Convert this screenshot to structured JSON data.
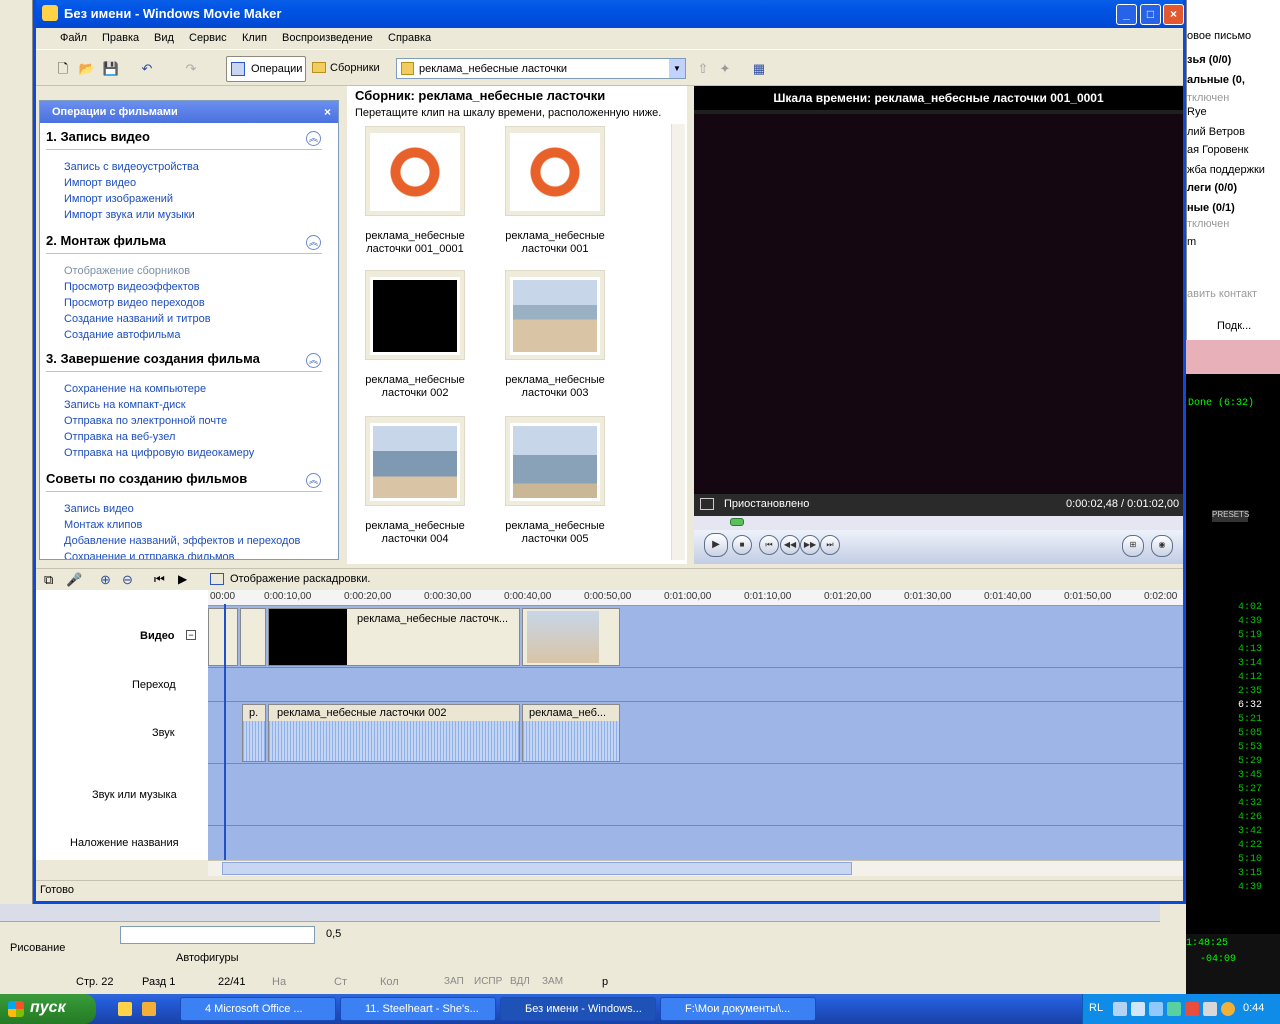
{
  "window": {
    "title": "Без имени - Windows Movie Maker"
  },
  "menu": [
    "Файл",
    "Правка",
    "Вид",
    "Сервис",
    "Клип",
    "Воспроизведение",
    "Справка"
  ],
  "toolbar": {
    "operations": "Операции",
    "collections": "Сборники",
    "collection_select": "реклама_небесные ласточки"
  },
  "tasks": {
    "header": "Операции с фильмами",
    "sections": [
      {
        "title": "1. Запись видео",
        "items": [
          "Запись с видеоустройства",
          "Импорт видео",
          "Импорт изображений",
          "Импорт звука или музыки"
        ]
      },
      {
        "title": "2. Монтаж фильма",
        "items": [
          "Отображение сборников",
          "Просмотр видеоэффектов",
          "Просмотр видео переходов",
          "Создание названий и титров",
          "Создание автофильма"
        ]
      },
      {
        "title": "3. Завершение создания фильма",
        "items": [
          "Сохранение на компьютере",
          "Запись на компакт-диск",
          "Отправка по электронной почте",
          "Отправка на веб-узел",
          "Отправка на цифровую видеокамеру"
        ]
      },
      {
        "title": "Советы по созданию фильмов",
        "items": [
          "Запись видео",
          "Монтаж клипов",
          "Добавление названий, эффектов и переходов",
          "Сохранение и отправка фильмов"
        ]
      }
    ]
  },
  "collection": {
    "title": "Сборник: реклама_небесные ласточки",
    "hint": "Перетащите клип на шкалу времени, расположенную ниже.",
    "clips": [
      {
        "line1": "реклама_небесные",
        "line2": "ласточки 001_0001"
      },
      {
        "line1": "реклама_небесные",
        "line2": "ласточки 001"
      },
      {
        "line1": "реклама_небесные",
        "line2": "ласточки 002"
      },
      {
        "line1": "реклама_небесные",
        "line2": "ласточки 003"
      },
      {
        "line1": "реклама_небесные",
        "line2": "ласточки 004"
      },
      {
        "line1": "реклама_небесные",
        "line2": "ласточки 005"
      }
    ]
  },
  "monitor": {
    "title": "Шкала времени: реклама_небесные ласточки 001_0001",
    "status": "Приостановлено",
    "time": "0:00:02,48 / 0:01:02,00",
    "progress": 0.04
  },
  "timeline": {
    "storyboard": "Отображение раскадровки.",
    "labels": {
      "video": "Видео",
      "transition": "Переход",
      "audio": "Звук",
      "music": "Звук или музыка",
      "title_overlay": "Наложение названия"
    },
    "ticks": [
      "00:00",
      "0:00:10,00",
      "0:00:20,00",
      "0:00:30,00",
      "0:00:40,00",
      "0:00:50,00",
      "0:01:00,00",
      "0:01:10,00",
      "0:01:20,00",
      "0:01:30,00",
      "0:01:40,00",
      "0:01:50,00",
      "0:02:00"
    ],
    "video_clip_label": "реклама_небесные ласточк...",
    "audio_clips": [
      "р.",
      "реклама_небесные ласточки 002",
      "реклама_неб..."
    ]
  },
  "status": "Готово",
  "taskbar": {
    "start": "пуск",
    "items": [
      "4 Microsoft Office ...",
      "11. Steelheart - She's...",
      "Без имени - Windows...",
      "F:\\Мои документы\\..."
    ],
    "lang": "RL",
    "clock": "0:44"
  },
  "chat": {
    "lines": [
      "овое письмо",
      "зья (0/0)",
      "альные (0,",
      "тключен",
      "Rye",
      "лий Ветров",
      "ая Горовенк",
      "жба поддержки",
      "леги (0/0)",
      "ные (0/1)",
      "тключен",
      "m",
      "авить контакт",
      "Подк..."
    ]
  },
  "winamp": {
    "times": [
      "4:02",
      "4:39",
      "5:19",
      "4:13",
      "3:14",
      "4:12",
      "2:35",
      "6:32",
      "5:21",
      "5:05",
      "5:53",
      "5:29",
      "3:45",
      "5:27",
      "4:32",
      "4:26",
      "3:42",
      "4:22",
      "5:10",
      "3:15",
      "4:39"
    ],
    "counter": "1:48:25",
    "counter2": "-04:09",
    "presets": "PRESETS",
    "status": "Done (6:32)"
  },
  "word": {
    "drawing": "Рисование",
    "autoshapes": "Автофигуры",
    "line_width": "0,5",
    "page": "Стр. 22",
    "section": "Разд 1",
    "pages": "22/41",
    "at": "На",
    "line": "Ст",
    "col": "Кол",
    "rec": "ЗАП",
    "trk": "ИСПР",
    "ext": "ВДЛ",
    "ovr": "ЗАМ",
    "lang": "р"
  }
}
